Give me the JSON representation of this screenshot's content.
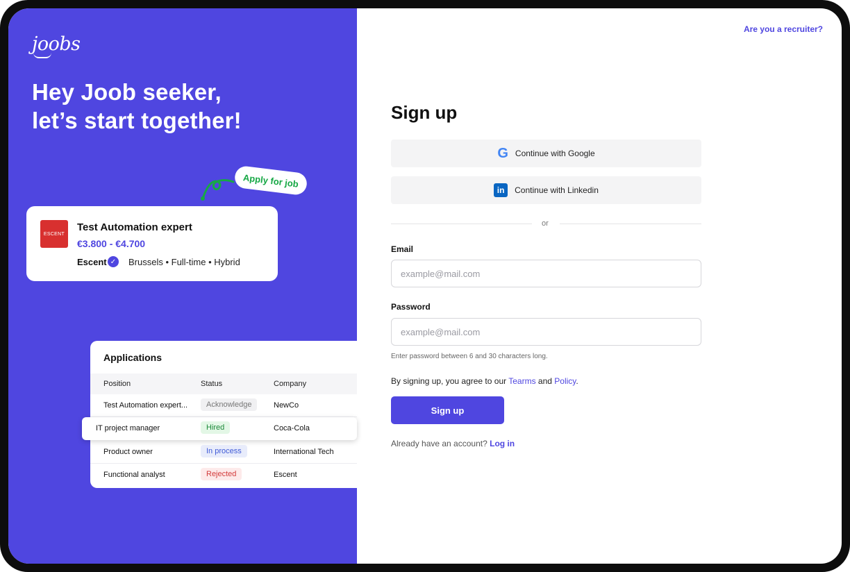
{
  "brand": {
    "logo": "joobs"
  },
  "hero": {
    "line1": "Hey Joob seeker,",
    "line2": "let’s start together!"
  },
  "apply_pill": "Apply for job",
  "job_card": {
    "company_logo_text": "ESCENT",
    "title": "Test Automation expert",
    "salary": "€3.800 - €4.700",
    "company": "Escent",
    "meta": "Brussels  •  Full-time  •  Hybrid"
  },
  "applications": {
    "title": "Applications",
    "columns": [
      "Position",
      "Status",
      "Company"
    ],
    "rows": [
      {
        "position": "Test Automation expert...",
        "status": "Acknowledge",
        "company": "NewCo"
      },
      {
        "position": "IT project manager",
        "status": "Hired",
        "company": "Coca-Cola"
      },
      {
        "position": "Product owner",
        "status": "In process",
        "company": "International Tech"
      },
      {
        "position": "Functional analyst",
        "status": "Rejected",
        "company": "Escent"
      }
    ]
  },
  "header": {
    "recruiter_link": "Are you a recruiter?"
  },
  "form": {
    "title": "Sign up",
    "google_label": "Continue with Google",
    "linkedin_label": "Continue with Linkedin",
    "or_text": "or",
    "email_label": "Email",
    "email_placeholder": "example@mail.com",
    "password_label": "Password",
    "password_placeholder": "example@mail.com",
    "password_hint": "Enter password between 6 and 30 characters long.",
    "terms_prefix": "By signing up, you agree to our ",
    "terms_link": "Tearms",
    "terms_and": " and ",
    "policy_link": "Policy",
    "terms_suffix": ".",
    "submit_label": "Sign up",
    "login_prefix": "Already have an account? ",
    "login_link": "Log in"
  },
  "colors": {
    "brand": "#4f46e0",
    "status_acknowledge": "#f0f0f2",
    "status_hired": "#e3f7e6",
    "status_in_process": "#e8ecfb",
    "status_rejected": "#fdeaea"
  }
}
